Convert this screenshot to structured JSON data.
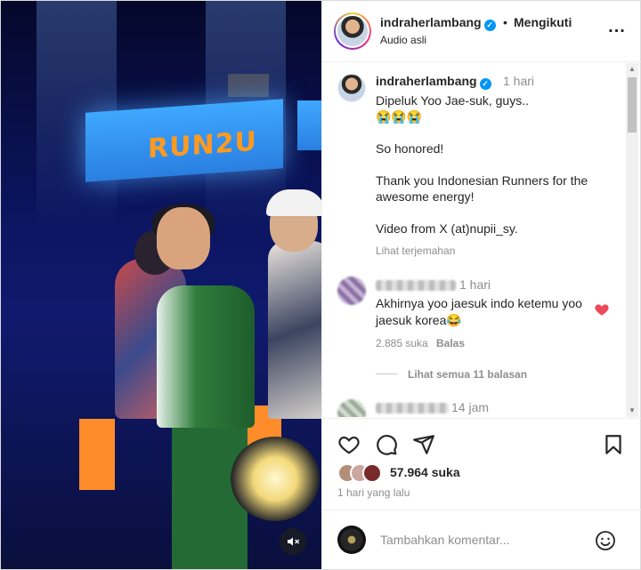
{
  "header": {
    "username": "indraherlambang",
    "separator": "•",
    "follow_label": "Mengikuti",
    "audio_label": "Audio asli",
    "more_label": "..."
  },
  "video": {
    "stage_logo": "RUN2U"
  },
  "caption": {
    "username": "indraherlambang",
    "time": "1 hari",
    "lines": [
      "Dipeluk Yoo Jae-suk, guys..",
      "😭😭😭",
      "",
      "So honored!",
      "",
      "Thank you Indonesian Runners for the awesome energy!",
      "",
      "Video from X (at)nupii_sy."
    ],
    "translate_label": "Lihat terjemahan"
  },
  "comments": [
    {
      "time": "1 hari",
      "text": "Akhirnya yoo jaesuk indo ketemu yoo jaesuk korea😂",
      "likes": "2.885 suka",
      "reply_label": "Balas",
      "view_replies": "Lihat semua 11 balasan",
      "liked": true
    },
    {
      "time": "14 jam"
    }
  ],
  "actions": {
    "likes_count": "57.964 suka",
    "date": "1 hari yang lalu"
  },
  "composer": {
    "placeholder": "Tambahkan komentar..."
  },
  "colors": {
    "verified": "#0095f6",
    "heart": "#ed4956",
    "muted_text": "#8e8e8e"
  }
}
